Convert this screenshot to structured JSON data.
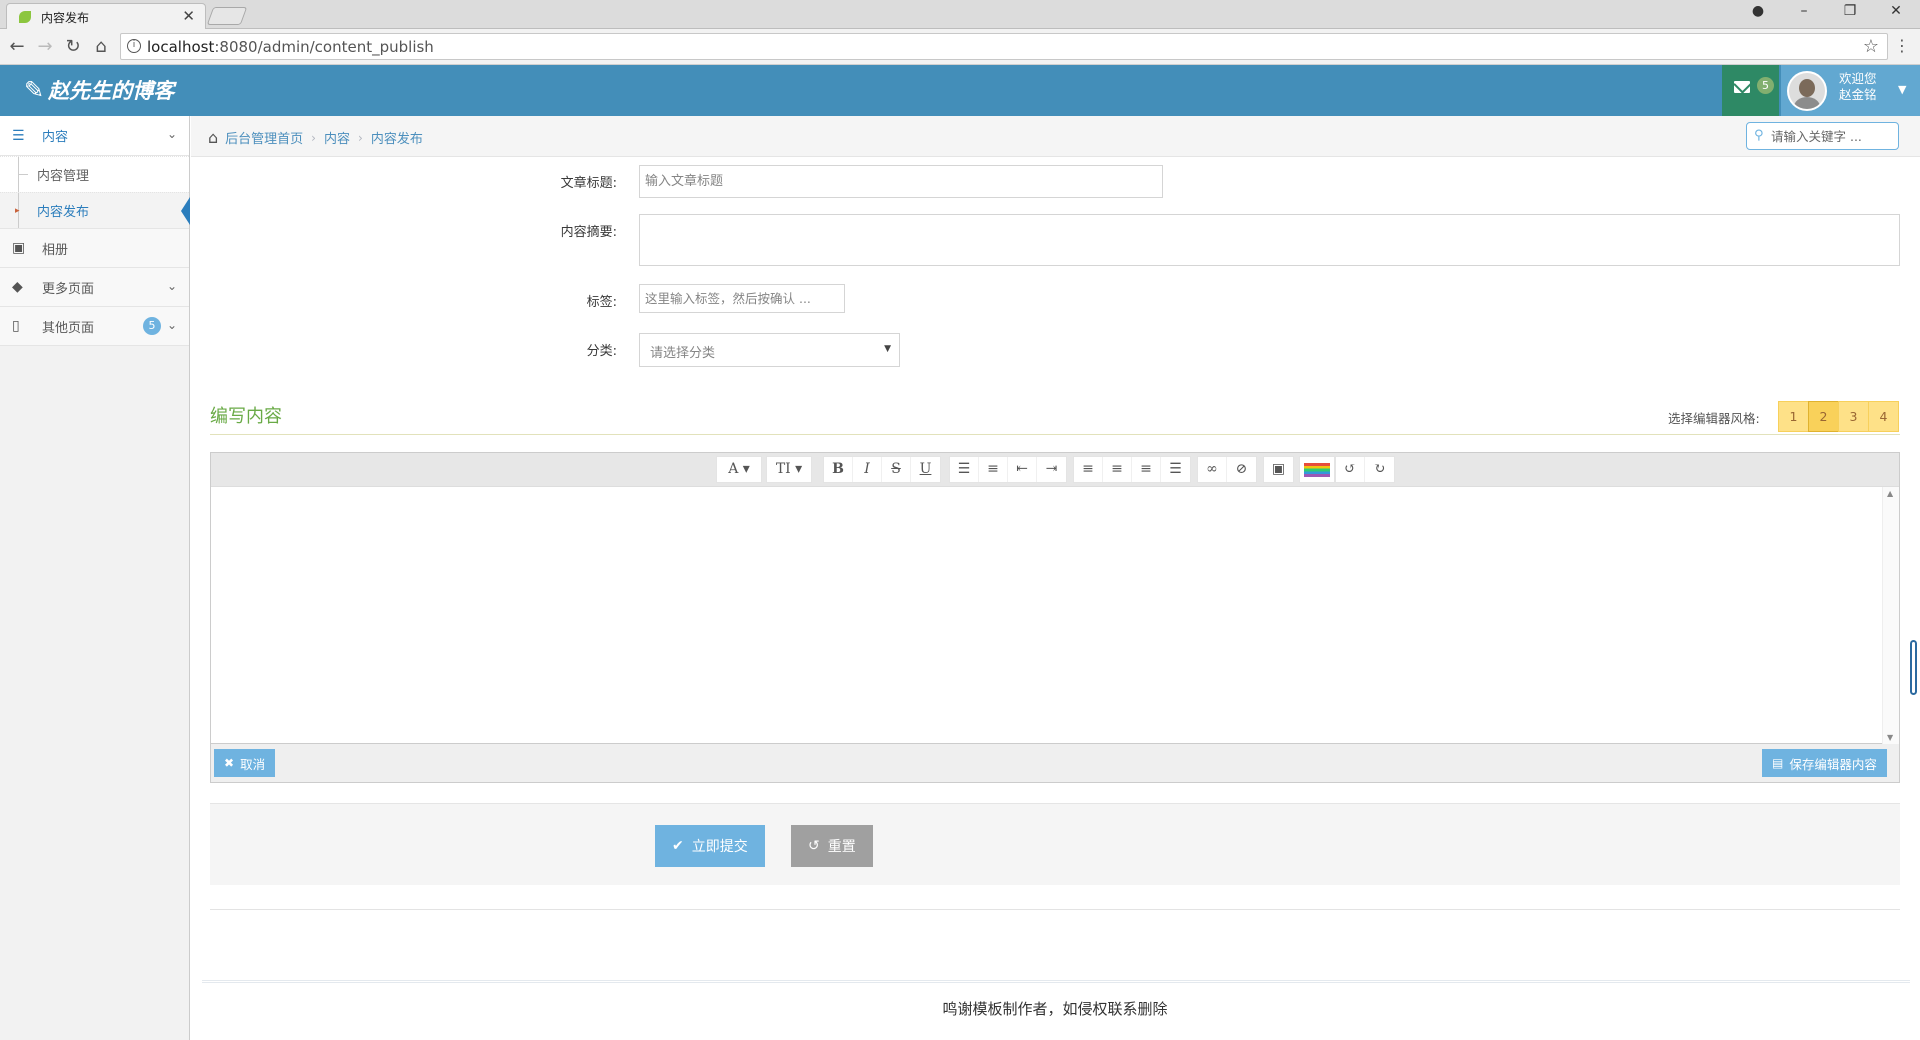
{
  "browser": {
    "tab_title": "内容发布",
    "tab_close": "✕",
    "url_host": "localhost",
    "url_rest": ":8080/admin/content_publish",
    "window_controls": [
      "–",
      "❐",
      "✕"
    ]
  },
  "header": {
    "brand": "赵先生的博客",
    "messages_badge": "5",
    "welcome_line1": "欢迎您",
    "welcome_line2": "赵金铭"
  },
  "sidebar": {
    "items": [
      {
        "label": "内容",
        "icon": "list-icon",
        "expanded": true,
        "children": [
          {
            "label": "内容管理"
          },
          {
            "label": "内容发布",
            "active": true
          }
        ]
      },
      {
        "label": "相册",
        "icon": "picture-icon"
      },
      {
        "label": "更多页面",
        "icon": "tag-icon"
      },
      {
        "label": "其他页面",
        "icon": "file-icon",
        "badge": "5"
      }
    ]
  },
  "breadcrumb": {
    "items": [
      "后台管理首页",
      "内容",
      "内容发布"
    ],
    "search_placeholder": "请输入关键字 ..."
  },
  "form": {
    "title_label": "文章标题:",
    "title_placeholder": "输入文章标题",
    "summary_label": "内容摘要:",
    "tags_label": "标签:",
    "tags_placeholder": "这里输入标签，然后按确认 ...",
    "category_label": "分类:",
    "category_value": "请选择分类"
  },
  "editor_section": {
    "title": "编写内容",
    "style_label": "选择编辑器风格:",
    "style_options": [
      "1",
      "2",
      "3",
      "4"
    ],
    "selected_style": "2",
    "cancel_label": "取消",
    "save_label": "保存编辑器内容"
  },
  "actions": {
    "submit_label": "立即提交",
    "reset_label": "重置"
  },
  "footer": {
    "text": "鸣谢模板制作者，如侵权联系删除"
  },
  "colors": {
    "header_bg": "#438eb9",
    "accent_green": "#69aa46",
    "link_blue": "#4c8fbd",
    "button_blue": "#6fb3e0"
  }
}
